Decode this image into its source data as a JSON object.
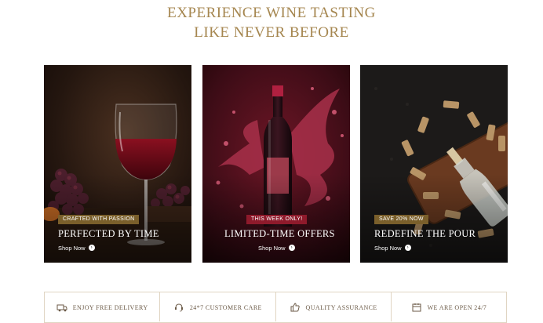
{
  "hero": {
    "title_line1": "EXPERIENCE WINE TASTING",
    "title_line2": "LIKE NEVER BEFORE"
  },
  "cards": [
    {
      "badge": "CRAFTED WITH PASSION",
      "heading": "PERFECTED BY TIME",
      "link": "Shop Now"
    },
    {
      "badge": "THIS WEEK ONLY!",
      "heading": "LIMITED-TIME OFFERS",
      "link": "Shop Now"
    },
    {
      "badge": "SAVE 20% NOW",
      "heading": "REDEFINE THE POUR",
      "link": "Shop Now"
    }
  ],
  "features": [
    {
      "label": "ENJOY FREE DELIVERY",
      "icon": "truck-icon"
    },
    {
      "label": "24*7 CUSTOMER CARE",
      "icon": "headset-icon"
    },
    {
      "label": "QUALITY ASSURANCE",
      "icon": "thumbs-up-icon"
    },
    {
      "label": "WE ARE OPEN 24/7",
      "icon": "calendar-icon"
    }
  ],
  "colors": {
    "accent_gold": "#a5864f",
    "badge_olive": "#7a5f2b",
    "badge_red": "#8e1a2b"
  }
}
